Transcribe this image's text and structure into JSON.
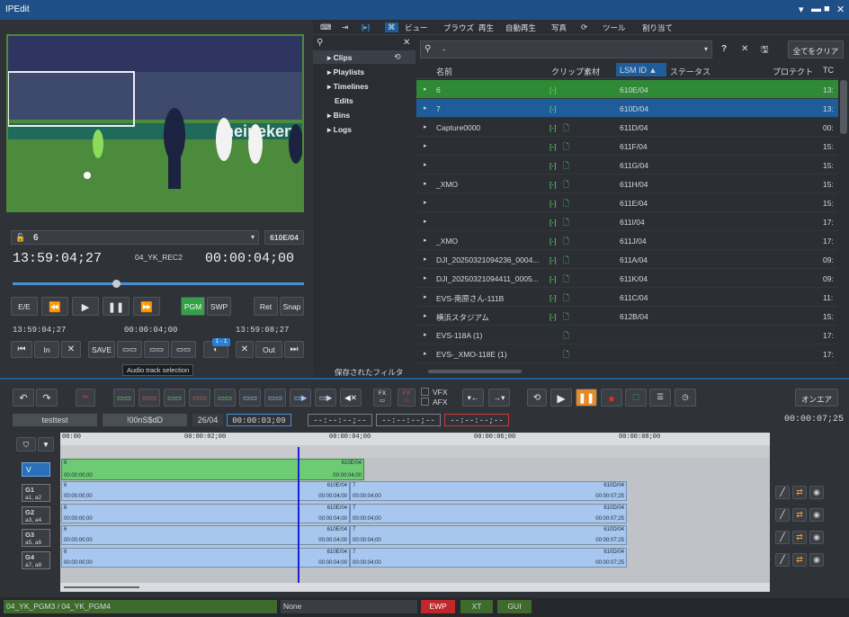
{
  "app": {
    "title": "IPEdit"
  },
  "player": {
    "clip_name": "6",
    "clip_id": "610E/04",
    "timecode": "13:59:04;27",
    "source": "04_YK_REC2",
    "duration": "00:00:04;00",
    "tc_in": "13:59:04;27",
    "tc_mid": "00:00:04;00",
    "tc_out": "13:59:08;27",
    "buttons": {
      "ee": "E/E",
      "pgm": "PGM",
      "swp": "SWP",
      "ret": "Ret",
      "snap": "Snap",
      "in": "In",
      "save": "SAVE",
      "out": "Out"
    },
    "badge": "1 - 1",
    "tooltip": "Audio track selection"
  },
  "toolbar": {
    "view": "ビュー",
    "browse": "ブラウズ",
    "play": "再生",
    "autoplay": "自動再生",
    "photo": "写真",
    "tools": "ツール",
    "assign": "割り当て"
  },
  "tree": [
    "Clips",
    "Playlists",
    "Timelines",
    "Edits",
    "Bins",
    "Logs"
  ],
  "search": {
    "value": "-",
    "clear_all": "全てをクリア"
  },
  "columns": {
    "name": "名前",
    "material": "クリップ素材",
    "lsm": "LSM ID",
    "status": "ステータス",
    "protect": "プロテクト",
    "tc": "TC"
  },
  "rows": [
    {
      "name": "6",
      "lsm": "610E/04",
      "tc": "13:"
    },
    {
      "name": "7",
      "lsm": "610D/04",
      "tc": "13:"
    },
    {
      "name": "Capture0000",
      "lsm": "611D/04",
      "tc": "00:"
    },
    {
      "name": "",
      "lsm": "611F/04",
      "tc": "15:"
    },
    {
      "name": "",
      "lsm": "611G/04",
      "tc": "15:"
    },
    {
      "name": "_XMO",
      "lsm": "611H/04",
      "tc": "15:"
    },
    {
      "name": "",
      "lsm": "611E/04",
      "tc": "15:"
    },
    {
      "name": "",
      "lsm": "611I/04",
      "tc": "17:"
    },
    {
      "name": "_XMO",
      "lsm": "611J/04",
      "tc": "17:"
    },
    {
      "name": "DJI_20250321094236_0004...",
      "lsm": "611A/04",
      "tc": "09:"
    },
    {
      "name": "DJI_20250321094411_0005...",
      "lsm": "611K/04",
      "tc": "09:"
    },
    {
      "name": "EVS-南原さん-111B",
      "lsm": "611C/04",
      "tc": "11:"
    },
    {
      "name": "横浜スタジアム",
      "lsm": "612B/04",
      "tc": "15:"
    },
    {
      "name": "EVS-118A (1)",
      "lsm": "",
      "tc": "17:"
    },
    {
      "name": "EVS-_XMO-118E (1)",
      "lsm": "",
      "tc": "17:"
    }
  ],
  "material_marks": "[-]",
  "saved_filter": "保存されたフィルタ",
  "timeline": {
    "name": "testtest",
    "code": "!00nS$dD",
    "count": "26/04",
    "tc": "00:00:03;09",
    "blank1": "--:--:--;--",
    "blank2": "--:--:--;--",
    "blank3": "--:--:--;--",
    "vfx": "VFX",
    "afx": "AFX",
    "onair": "オンエア",
    "total": "00:00:07;25",
    "ruler": [
      "00:00",
      "00:00:02;00",
      "00:00:04;00",
      "00:00:06;00",
      "00:00:08;00"
    ],
    "tracks": [
      {
        "label": "V",
        "sub": ""
      },
      {
        "label": "G1",
        "sub": "a1, a2"
      },
      {
        "label": "G2",
        "sub": "a3, a4"
      },
      {
        "label": "G3",
        "sub": "a5, a6"
      },
      {
        "label": "G4",
        "sub": "a7, a8"
      }
    ],
    "clipA": {
      "num": "6",
      "id": "610E/04",
      "start": "00:00:00;00",
      "end": "00:00:04;00"
    },
    "clipB": {
      "num": "7",
      "id": "610D/04",
      "start": "00:00:04;00",
      "end": "00:00:07;25"
    }
  },
  "status": {
    "channel": "04_YK_PGM3 / 04_YK_PGM4",
    "mode": "None",
    "ewp": "EWP",
    "xt": "XT",
    "gui": "GUI"
  },
  "colors": {
    "accent": "#1e4f86",
    "selected_green": "#2f8a36",
    "selected_blue": "#1f5d9a",
    "video_clip": "#6dcb74",
    "audio_clip": "#a7c7ee"
  }
}
